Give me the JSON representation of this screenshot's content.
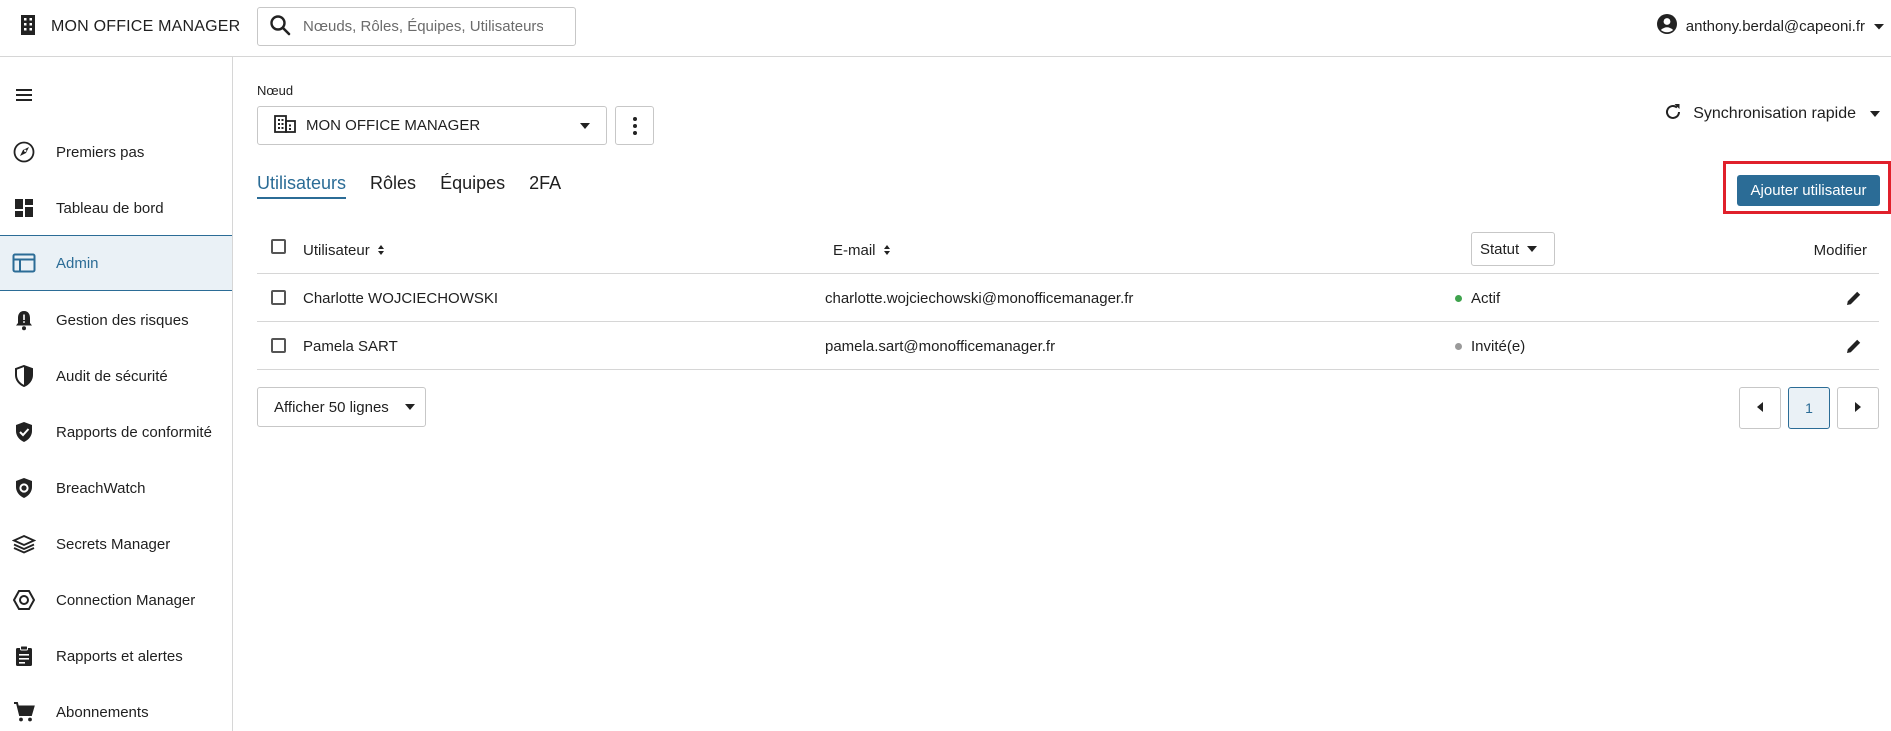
{
  "header": {
    "app_name": "MON OFFICE MANAGER",
    "search_placeholder": "Nœuds, Rôles, Équipes, Utilisateurs",
    "account_email": "anthony.berdal@capeoni.fr"
  },
  "sidebar": {
    "items": [
      {
        "label": "Premiers pas",
        "icon": "rocket-icon"
      },
      {
        "label": "Tableau de bord",
        "icon": "dashboard-icon"
      },
      {
        "label": "Admin",
        "icon": "admin-panel-icon",
        "active": true
      },
      {
        "label": "Gestion des risques",
        "icon": "bell-alert-icon"
      },
      {
        "label": "Audit de sécurité",
        "icon": "shield-half-icon"
      },
      {
        "label": "Rapports de conformité",
        "icon": "shield-check-icon"
      },
      {
        "label": "BreachWatch",
        "icon": "breachwatch-shield-icon"
      },
      {
        "label": "Secrets Manager",
        "icon": "layers-icon"
      },
      {
        "label": "Connection Manager",
        "icon": "hexagon-icon"
      },
      {
        "label": "Rapports et alertes",
        "icon": "clipboard-icon"
      },
      {
        "label": "Abonnements",
        "icon": "cart-icon"
      }
    ]
  },
  "main": {
    "node_label": "Nœud",
    "node_value": "MON OFFICE MANAGER",
    "sync_label": "Synchronisation rapide",
    "tabs": [
      {
        "label": "Utilisateurs",
        "active": true
      },
      {
        "label": "Rôles"
      },
      {
        "label": "Équipes"
      },
      {
        "label": "2FA"
      }
    ],
    "add_user_label": "Ajouter utilisateur",
    "table": {
      "columns": {
        "user": "Utilisateur",
        "email": "E-mail",
        "status": "Statut",
        "edit": "Modifier"
      },
      "rows": [
        {
          "name": "Charlotte WOJCIECHOWSKI",
          "email": "charlotte.wojciechowski@monofficemanager.fr",
          "status": "Actif",
          "status_color": "#3fa34d"
        },
        {
          "name": "Pamela SART",
          "email": "pamela.sart@monofficemanager.fr",
          "status": "Invité(e)",
          "status_color": "#9a9a9a"
        }
      ]
    },
    "rows_per_page_label": "Afficher 50 lignes",
    "pagination": {
      "current_page": "1"
    }
  },
  "colors": {
    "accent": "#2b6c96",
    "highlight_box": "#e0202b"
  }
}
